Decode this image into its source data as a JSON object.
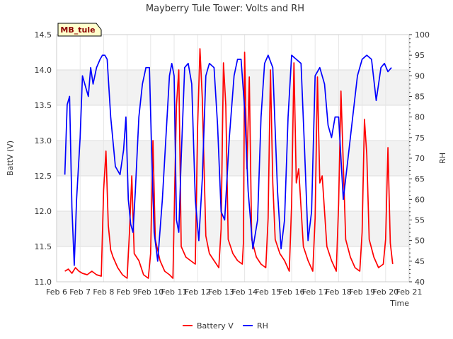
{
  "chart_data": {
    "type": "line",
    "title": "Mayberry Tule Tower: Volts and RH",
    "station_tag": "MB_tule",
    "xlabel": "Time",
    "ylabel_left": "BattV (V)",
    "ylabel_right": "RH",
    "x_range": [
      6,
      21
    ],
    "x_ticks": [
      6,
      7,
      8,
      9,
      10,
      11,
      12,
      13,
      14,
      15,
      16,
      17,
      18,
      19,
      20,
      21
    ],
    "x_tick_labels": [
      "Feb 6",
      "Feb 7",
      "Feb 8",
      "Feb 9",
      "Feb 10",
      "Feb 11",
      "Feb 12",
      "Feb 13",
      "Feb 14",
      "Feb 15",
      "Feb 16",
      "Feb 17",
      "Feb 18",
      "Feb 19",
      "Feb 20",
      "Feb 21"
    ],
    "ylim_left": [
      11.0,
      14.5
    ],
    "y_ticks_left": [
      "11.0",
      "11.5",
      "12.0",
      "12.5",
      "13.0",
      "13.5",
      "14.0",
      "14.5"
    ],
    "ylim_right": [
      40,
      100
    ],
    "y_ticks_right": [
      "40",
      "45",
      "50",
      "55",
      "60",
      "65",
      "70",
      "75",
      "80",
      "85",
      "90",
      "95",
      "100"
    ],
    "grid": true,
    "legend_position": "bottom-center",
    "series": [
      {
        "name": "Battery V",
        "color": "#ff0000",
        "axis": "left",
        "x": [
          6.35,
          6.5,
          6.65,
          6.8,
          6.95,
          7.1,
          7.3,
          7.5,
          7.7,
          7.9,
          8.0,
          8.1,
          8.2,
          8.3,
          8.4,
          8.6,
          8.8,
          9.0,
          9.1,
          9.2,
          9.3,
          9.5,
          9.7,
          9.9,
          10.0,
          10.1,
          10.2,
          10.4,
          10.6,
          10.8,
          10.95,
          11.0,
          11.1,
          11.2,
          11.3,
          11.5,
          11.7,
          11.9,
          12.0,
          12.1,
          12.2,
          12.35,
          12.5,
          12.7,
          12.9,
          13.0,
          13.1,
          13.2,
          13.3,
          13.5,
          13.7,
          13.9,
          13.95,
          14.0,
          14.1,
          14.2,
          14.3,
          14.5,
          14.7,
          14.9,
          15.0,
          15.1,
          15.2,
          15.3,
          15.5,
          15.7,
          15.9,
          16.0,
          16.1,
          16.2,
          16.3,
          16.5,
          16.7,
          16.9,
          17.0,
          17.1,
          17.2,
          17.3,
          17.5,
          17.7,
          17.9,
          18.0,
          18.1,
          18.3,
          18.5,
          18.7,
          18.9,
          19.0,
          19.1,
          19.2,
          19.3,
          19.5,
          19.7,
          19.9,
          20.0,
          20.1,
          20.2,
          20.3
        ],
        "values": [
          11.15,
          11.18,
          11.12,
          11.2,
          11.15,
          11.12,
          11.1,
          11.15,
          11.1,
          11.08,
          12.3,
          12.85,
          11.8,
          11.45,
          11.35,
          11.2,
          11.1,
          11.05,
          11.7,
          12.5,
          11.4,
          11.3,
          11.1,
          11.05,
          11.4,
          13.0,
          11.6,
          11.3,
          11.15,
          11.1,
          11.05,
          11.9,
          13.5,
          14.0,
          11.5,
          11.35,
          11.3,
          11.25,
          13.2,
          14.3,
          13.6,
          11.65,
          11.4,
          11.3,
          11.2,
          11.75,
          14.1,
          13.5,
          11.6,
          11.4,
          11.3,
          11.25,
          11.55,
          14.25,
          12.6,
          13.9,
          11.6,
          11.35,
          11.25,
          11.2,
          11.9,
          14.0,
          12.4,
          11.6,
          11.4,
          11.3,
          11.15,
          12.1,
          14.1,
          12.4,
          12.6,
          11.5,
          11.3,
          11.15,
          11.9,
          13.9,
          12.4,
          12.5,
          11.5,
          11.3,
          11.15,
          12.1,
          13.7,
          11.6,
          11.35,
          11.2,
          11.15,
          11.7,
          13.3,
          12.8,
          11.6,
          11.35,
          11.2,
          11.25,
          11.6,
          12.9,
          11.55,
          11.25
        ]
      },
      {
        "name": "RH",
        "color": "#0000ff",
        "axis": "right",
        "x": [
          6.35,
          6.45,
          6.55,
          6.65,
          6.75,
          6.85,
          7.0,
          7.1,
          7.2,
          7.35,
          7.45,
          7.55,
          7.7,
          7.85,
          7.95,
          8.05,
          8.15,
          8.3,
          8.5,
          8.7,
          8.85,
          8.95,
          9.05,
          9.15,
          9.25,
          9.35,
          9.5,
          9.65,
          9.8,
          9.95,
          10.05,
          10.15,
          10.3,
          10.5,
          10.65,
          10.8,
          10.9,
          11.0,
          11.1,
          11.2,
          11.3,
          11.45,
          11.6,
          11.75,
          11.9,
          12.05,
          12.2,
          12.35,
          12.5,
          12.7,
          12.85,
          13.0,
          13.15,
          13.35,
          13.55,
          13.7,
          13.85,
          14.0,
          14.15,
          14.35,
          14.55,
          14.7,
          14.85,
          15.0,
          15.2,
          15.4,
          15.55,
          15.7,
          15.85,
          16.0,
          16.2,
          16.4,
          16.55,
          16.7,
          16.85,
          17.0,
          17.2,
          17.4,
          17.55,
          17.7,
          17.85,
          18.0,
          18.2,
          18.4,
          18.6,
          18.8,
          19.0,
          19.2,
          19.4,
          19.6,
          19.8,
          19.95,
          20.1,
          20.25
        ],
        "values": [
          66,
          83,
          85,
          58,
          44,
          60,
          75,
          90,
          88,
          85,
          92,
          88,
          92,
          94,
          95,
          95,
          94,
          80,
          68,
          66,
          72,
          80,
          60,
          54,
          52,
          62,
          80,
          88,
          92,
          92,
          70,
          52,
          45,
          60,
          75,
          90,
          93,
          90,
          55,
          52,
          70,
          92,
          93,
          88,
          60,
          50,
          65,
          90,
          93,
          92,
          78,
          57,
          55,
          75,
          90,
          94,
          94,
          82,
          62,
          48,
          55,
          80,
          93,
          95,
          92,
          62,
          48,
          55,
          80,
          95,
          94,
          93,
          72,
          50,
          57,
          90,
          92,
          88,
          78,
          75,
          80,
          80,
          60,
          70,
          80,
          90,
          94,
          95,
          94,
          84,
          92,
          93,
          91,
          92
        ]
      }
    ]
  }
}
